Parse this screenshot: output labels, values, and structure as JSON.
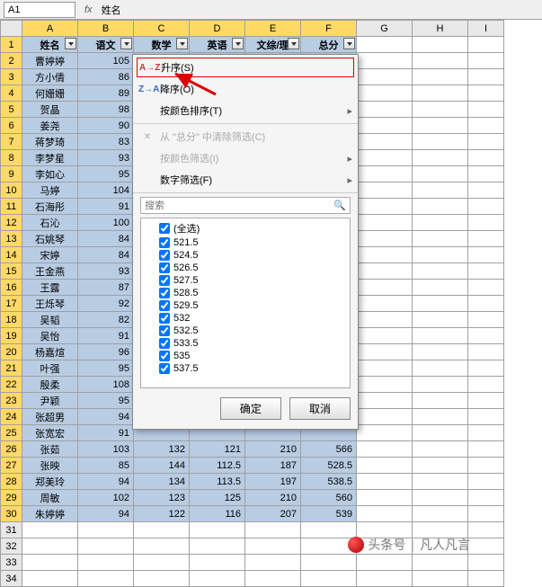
{
  "formula_bar": {
    "cell_ref": "A1",
    "fx": "fx",
    "value": "姓名"
  },
  "columns": [
    "A",
    "B",
    "C",
    "D",
    "E",
    "F",
    "G",
    "H",
    "I"
  ],
  "row_nums": [
    1,
    2,
    3,
    4,
    5,
    6,
    7,
    8,
    9,
    10,
    11,
    12,
    13,
    14,
    15,
    16,
    17,
    18,
    19,
    20,
    21,
    22,
    23,
    24,
    25,
    26,
    27,
    28,
    29,
    30,
    31,
    32,
    33,
    34
  ],
  "headers": [
    "姓名",
    "语文",
    "数学",
    "英语",
    "文综/理",
    "总分"
  ],
  "rows": [
    {
      "name": "曹婷婷",
      "yuwen": 105
    },
    {
      "name": "方小倩",
      "yuwen": 86
    },
    {
      "name": "何姗姗",
      "yuwen": 89
    },
    {
      "name": "贺晶",
      "yuwen": 98
    },
    {
      "name": "姜尧",
      "yuwen": 90
    },
    {
      "name": "蒋梦琦",
      "yuwen": 83
    },
    {
      "name": "李梦星",
      "yuwen": 93
    },
    {
      "name": "李如心",
      "yuwen": 95
    },
    {
      "name": "马婷",
      "yuwen": 104
    },
    {
      "name": "石海彤",
      "yuwen": 91
    },
    {
      "name": "石沁",
      "yuwen": 100
    },
    {
      "name": "石姚琴",
      "yuwen": 84
    },
    {
      "name": "宋婷",
      "yuwen": 84
    },
    {
      "name": "王金燕",
      "yuwen": 93
    },
    {
      "name": "王露",
      "yuwen": 87
    },
    {
      "name": "王烁琴",
      "yuwen": 92
    },
    {
      "name": "吴韬",
      "yuwen": 82
    },
    {
      "name": "吴怡",
      "yuwen": 91
    },
    {
      "name": "杨嘉煊",
      "yuwen": 96
    },
    {
      "name": "叶强",
      "yuwen": 95
    },
    {
      "name": "殷柔",
      "yuwen": 108
    },
    {
      "name": "尹颖",
      "yuwen": 95
    },
    {
      "name": "张超男",
      "yuwen": 94
    },
    {
      "name": "张宽宏",
      "yuwen": 91
    },
    {
      "name": "张茹",
      "yuwen": 103,
      "c": 132,
      "d": 121,
      "e": 210,
      "f": 566
    },
    {
      "name": "张映",
      "yuwen": 85,
      "c": 144,
      "d": 112.5,
      "e": 187,
      "f": 528.5
    },
    {
      "name": "郑美玲",
      "yuwen": 94,
      "c": 134,
      "d": 113.5,
      "e": 197,
      "f": 538.5
    },
    {
      "name": "周敏",
      "yuwen": 102,
      "c": 123,
      "d": 125,
      "e": 210,
      "f": 560
    },
    {
      "name": "朱婷婷",
      "yuwen": 94,
      "c": 122,
      "d": 116,
      "e": 207,
      "f": 539
    }
  ],
  "menu": {
    "sort_asc": "升序(S)",
    "sort_desc": "降序(O)",
    "sort_color": "按颜色排序(T)",
    "clear_filter": "从 \"总分\" 中清除筛选(C)",
    "filter_color": "按颜色筛选(I)",
    "num_filter": "数字筛选(F)",
    "search": "搜索",
    "select_all": "(全选)",
    "options": [
      "521.5",
      "524.5",
      "526.5",
      "527.5",
      "528.5",
      "529.5",
      "532",
      "532.5",
      "533.5",
      "535",
      "537.5"
    ],
    "ok": "确定",
    "cancel": "取消"
  },
  "icons": {
    "asc": "A→Z↓",
    "desc": "Z→A↓",
    "clear": "✕"
  },
  "watermark": {
    "brand": "头条号",
    "author": "凡人凡言"
  }
}
